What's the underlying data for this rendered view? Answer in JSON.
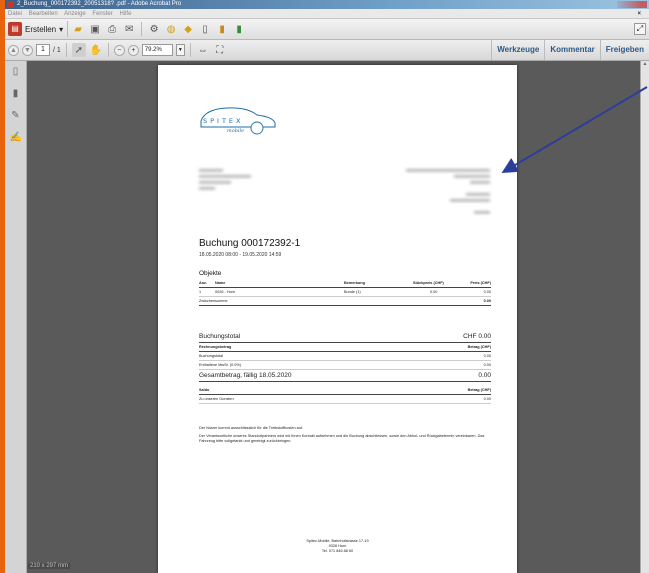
{
  "window": {
    "title": "2_Buchung_000172392_20051318? .pdf - Adobe Acrobat Pro"
  },
  "menu": [
    "Datei",
    "Bearbeiten",
    "Anzeige",
    "Fenster",
    "Hilfe"
  ],
  "toolbar": {
    "create_label": "Erstellen"
  },
  "nav": {
    "page_current": "1",
    "page_total": "/ 1",
    "zoom": "79.2%"
  },
  "panels": {
    "tools": "Werkzeuge",
    "comment": "Kommentar",
    "share": "Freigeben"
  },
  "status": {
    "page_size": "210 x 297 mm"
  },
  "document": {
    "logo_text": "SPITEX",
    "logo_sub": "mobile",
    "title": "Buchung 000172392-1",
    "date_range": "18.05.2020 08:00 - 19.05.2020 14:59",
    "objects_title": "Objekte",
    "objects_headers": [
      "Anz.",
      "Name",
      "Bemerkung",
      "Stückpreis (CHF)",
      "Preis (CHF)"
    ],
    "objects_row": [
      "1",
      "0026 - Horn",
      "Bunde (1)",
      "0.00",
      "0.00"
    ],
    "subtotal_label": "Zwischensumme",
    "subtotal_value": "0.00",
    "total_title": "Buchungstotal",
    "total_title_value": "CHF 0.00",
    "billing_label": "Rechnungsbetrag",
    "billing_header": "Betrag (CHF)",
    "booking_total_label": "Buchungstotal",
    "booking_total_value": "0.00",
    "vat_label": "Enthaltene MwSt. (0.0%)",
    "vat_value": "0.00",
    "grand_label": "Gesamtbetrag, fällig 18.05.2020",
    "grand_value": "0.00",
    "saldo_label": "Saldo",
    "saldo_header": "Betrag (CHF)",
    "favor_label": "Zu unseren Gunsten",
    "favor_value": "0.00",
    "note1": "Der Nutzer kommt ausschliesslich für die Treibstoffkosten auf.",
    "note2": "Der Verantwortliche unseres Standortpartners wird mit Ihnen Kontakt aufnehmen und die Buchung abschliessen, sowie den Abhol- und Rückgabetermin vereinbaren. Das Fahrzeug bitte vollgetankt und gereinigt zurückbringen.",
    "footer1": "Spitex-Mobile, Bahnhofstrasse 17-19",
    "footer2": "9326 Horn",
    "footer3": "Tel. 071 846 88 60"
  },
  "colors": {
    "accent": "#2e5a87",
    "background": "#e8640c",
    "arrow": "#2c3e9c"
  }
}
